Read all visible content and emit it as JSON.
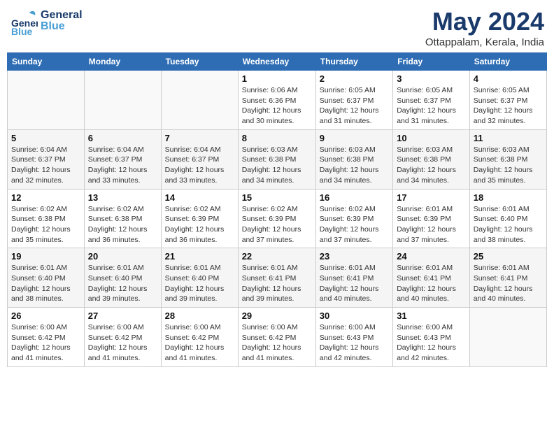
{
  "header": {
    "logo_general": "General",
    "logo_blue": "Blue",
    "month": "May 2024",
    "location": "Ottappalam, Kerala, India"
  },
  "weekdays": [
    "Sunday",
    "Monday",
    "Tuesday",
    "Wednesday",
    "Thursday",
    "Friday",
    "Saturday"
  ],
  "weeks": [
    [
      {
        "day": "",
        "detail": ""
      },
      {
        "day": "",
        "detail": ""
      },
      {
        "day": "",
        "detail": ""
      },
      {
        "day": "1",
        "detail": "Sunrise: 6:06 AM\nSunset: 6:36 PM\nDaylight: 12 hours\nand 30 minutes."
      },
      {
        "day": "2",
        "detail": "Sunrise: 6:05 AM\nSunset: 6:37 PM\nDaylight: 12 hours\nand 31 minutes."
      },
      {
        "day": "3",
        "detail": "Sunrise: 6:05 AM\nSunset: 6:37 PM\nDaylight: 12 hours\nand 31 minutes."
      },
      {
        "day": "4",
        "detail": "Sunrise: 6:05 AM\nSunset: 6:37 PM\nDaylight: 12 hours\nand 32 minutes."
      }
    ],
    [
      {
        "day": "5",
        "detail": "Sunrise: 6:04 AM\nSunset: 6:37 PM\nDaylight: 12 hours\nand 32 minutes."
      },
      {
        "day": "6",
        "detail": "Sunrise: 6:04 AM\nSunset: 6:37 PM\nDaylight: 12 hours\nand 33 minutes."
      },
      {
        "day": "7",
        "detail": "Sunrise: 6:04 AM\nSunset: 6:37 PM\nDaylight: 12 hours\nand 33 minutes."
      },
      {
        "day": "8",
        "detail": "Sunrise: 6:03 AM\nSunset: 6:38 PM\nDaylight: 12 hours\nand 34 minutes."
      },
      {
        "day": "9",
        "detail": "Sunrise: 6:03 AM\nSunset: 6:38 PM\nDaylight: 12 hours\nand 34 minutes."
      },
      {
        "day": "10",
        "detail": "Sunrise: 6:03 AM\nSunset: 6:38 PM\nDaylight: 12 hours\nand 34 minutes."
      },
      {
        "day": "11",
        "detail": "Sunrise: 6:03 AM\nSunset: 6:38 PM\nDaylight: 12 hours\nand 35 minutes."
      }
    ],
    [
      {
        "day": "12",
        "detail": "Sunrise: 6:02 AM\nSunset: 6:38 PM\nDaylight: 12 hours\nand 35 minutes."
      },
      {
        "day": "13",
        "detail": "Sunrise: 6:02 AM\nSunset: 6:38 PM\nDaylight: 12 hours\nand 36 minutes."
      },
      {
        "day": "14",
        "detail": "Sunrise: 6:02 AM\nSunset: 6:39 PM\nDaylight: 12 hours\nand 36 minutes."
      },
      {
        "day": "15",
        "detail": "Sunrise: 6:02 AM\nSunset: 6:39 PM\nDaylight: 12 hours\nand 37 minutes."
      },
      {
        "day": "16",
        "detail": "Sunrise: 6:02 AM\nSunset: 6:39 PM\nDaylight: 12 hours\nand 37 minutes."
      },
      {
        "day": "17",
        "detail": "Sunrise: 6:01 AM\nSunset: 6:39 PM\nDaylight: 12 hours\nand 37 minutes."
      },
      {
        "day": "18",
        "detail": "Sunrise: 6:01 AM\nSunset: 6:40 PM\nDaylight: 12 hours\nand 38 minutes."
      }
    ],
    [
      {
        "day": "19",
        "detail": "Sunrise: 6:01 AM\nSunset: 6:40 PM\nDaylight: 12 hours\nand 38 minutes."
      },
      {
        "day": "20",
        "detail": "Sunrise: 6:01 AM\nSunset: 6:40 PM\nDaylight: 12 hours\nand 39 minutes."
      },
      {
        "day": "21",
        "detail": "Sunrise: 6:01 AM\nSunset: 6:40 PM\nDaylight: 12 hours\nand 39 minutes."
      },
      {
        "day": "22",
        "detail": "Sunrise: 6:01 AM\nSunset: 6:41 PM\nDaylight: 12 hours\nand 39 minutes."
      },
      {
        "day": "23",
        "detail": "Sunrise: 6:01 AM\nSunset: 6:41 PM\nDaylight: 12 hours\nand 40 minutes."
      },
      {
        "day": "24",
        "detail": "Sunrise: 6:01 AM\nSunset: 6:41 PM\nDaylight: 12 hours\nand 40 minutes."
      },
      {
        "day": "25",
        "detail": "Sunrise: 6:01 AM\nSunset: 6:41 PM\nDaylight: 12 hours\nand 40 minutes."
      }
    ],
    [
      {
        "day": "26",
        "detail": "Sunrise: 6:00 AM\nSunset: 6:42 PM\nDaylight: 12 hours\nand 41 minutes."
      },
      {
        "day": "27",
        "detail": "Sunrise: 6:00 AM\nSunset: 6:42 PM\nDaylight: 12 hours\nand 41 minutes."
      },
      {
        "day": "28",
        "detail": "Sunrise: 6:00 AM\nSunset: 6:42 PM\nDaylight: 12 hours\nand 41 minutes."
      },
      {
        "day": "29",
        "detail": "Sunrise: 6:00 AM\nSunset: 6:42 PM\nDaylight: 12 hours\nand 41 minutes."
      },
      {
        "day": "30",
        "detail": "Sunrise: 6:00 AM\nSunset: 6:43 PM\nDaylight: 12 hours\nand 42 minutes."
      },
      {
        "day": "31",
        "detail": "Sunrise: 6:00 AM\nSunset: 6:43 PM\nDaylight: 12 hours\nand 42 minutes."
      },
      {
        "day": "",
        "detail": ""
      }
    ]
  ]
}
